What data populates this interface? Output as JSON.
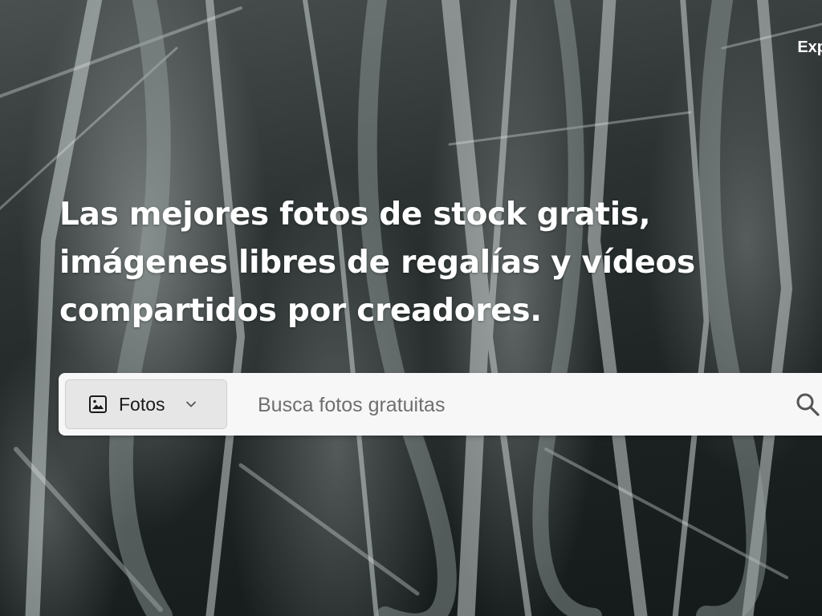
{
  "nav": {
    "explore_label": "Exp"
  },
  "hero": {
    "headline_line1": "Las mejores fotos de stock gratis,",
    "headline_line2": "imágenes libres de regalías y vídeos",
    "headline_line3": "compartidos por creadores."
  },
  "search": {
    "type_selected": "Fotos",
    "type_icon": "image-icon",
    "placeholder": "Busca fotos gratuitas",
    "value": "",
    "submit_icon": "search-icon"
  },
  "colors": {
    "headline_text": "#ffffff",
    "search_background": "#f7f7f7",
    "type_select_background": "#e6e6e6",
    "placeholder_text": "#6f6f6f"
  }
}
